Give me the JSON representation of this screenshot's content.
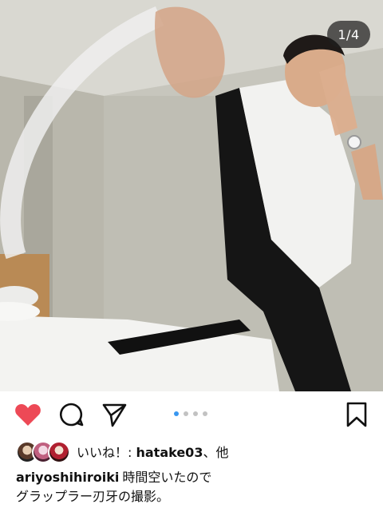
{
  "post": {
    "image_counter": "1/4",
    "carousel": {
      "total": 4,
      "current": 1
    }
  },
  "actions": {
    "like_color": "#ed4956",
    "active_dot_color": "#3897f0"
  },
  "likes": {
    "prefix": "いいね！: ",
    "user": "hatake03",
    "suffix": "、他"
  },
  "caption": {
    "username": "ariyoshihiroiki",
    "line1": "時間空いたので",
    "line2": "グラップラー刃牙の撮影。"
  }
}
